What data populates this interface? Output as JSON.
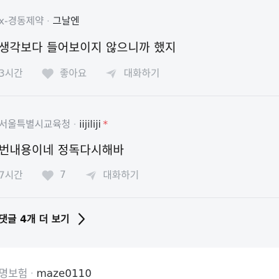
{
  "comments": [
    {
      "company": "x-경동제약",
      "author": "그날엔",
      "text": "생각보다 들어보이지 않으니까 했지",
      "time": "3시간",
      "like_label": "좋아요",
      "reply_label": "대화하기"
    },
    {
      "company": "서울특별시교육청",
      "author": "iijiliji",
      "op_marker": "*",
      "text": "번내용이네 정독다시해바",
      "time": "7시간",
      "like_label": "7",
      "reply_label": "대화하기"
    }
  ],
  "more_replies": {
    "label": "댓글 4개 더 보기"
  },
  "next_comment": {
    "company": "명보험",
    "author": "maze0110"
  },
  "colors": {
    "background": "#f5f6f8",
    "meta": "#8d929a",
    "op_marker": "#e5484d"
  }
}
